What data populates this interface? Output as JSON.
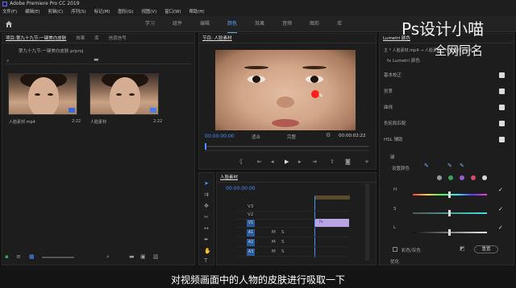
{
  "titlebar": {
    "title": "Adobe Premiere Pro CC 2019"
  },
  "menu": [
    "文件(F)",
    "编辑(E)",
    "剪辑(C)",
    "序列(S)",
    "标记(M)",
    "图形(G)",
    "视图(V)",
    "窗口(W)",
    "帮助(H)"
  ],
  "workspace_tabs": [
    "学习",
    "组件",
    "编辑",
    "颜色",
    "效果",
    "音频",
    "图形",
    "库"
  ],
  "project_panel": {
    "tabs": [
      "项目:第九十九节:一键美白皮肤",
      "效果",
      "库",
      "信息信号"
    ],
    "path": "第九十九节:一键美白皮肤.prproj",
    "items": [
      {
        "name": "人脸素材.mp4",
        "duration": "2:22"
      },
      {
        "name": "人脸素材",
        "duration": "2:22"
      }
    ]
  },
  "monitor": {
    "tab": "节目: 人脸素材",
    "timecode_left": "00:00:00:00",
    "fit_label": "适合",
    "quality_label": "完整",
    "timecode_right": "00:00:02:22"
  },
  "timeline": {
    "tab": "人脸素材",
    "timecode": "00:00:00:00",
    "tracks": [
      "V3",
      "V2",
      "V1",
      "A1",
      "A2",
      "A3"
    ]
  },
  "lumetri": {
    "panel_title": "Lumetri 颜色",
    "source_label": "主 * 人脸素材.mp4 → 人脸素材 * 人脸素材.mp4",
    "fx_label": "fx  Lumetri 颜色",
    "sections": [
      "基本校正",
      "创意",
      "曲线",
      "色轮和匹配",
      "HSL 辅助"
    ],
    "key_label": "键",
    "set_color_label": "设置颜色",
    "hsl": [
      "H",
      "S",
      "L"
    ],
    "color_gray_label": "彩色/灰色",
    "reset_button": "重置",
    "refine_label": "优化"
  },
  "watermark": {
    "line1": "Ps设计小喵",
    "line2": "全网同名"
  },
  "subtitle": "对视频画面中的人物的皮肤进行吸取一下",
  "colors": {
    "accent": "#4a90ff",
    "picker": "#ff1f1f",
    "clip_purple": "#b9a3e3"
  }
}
